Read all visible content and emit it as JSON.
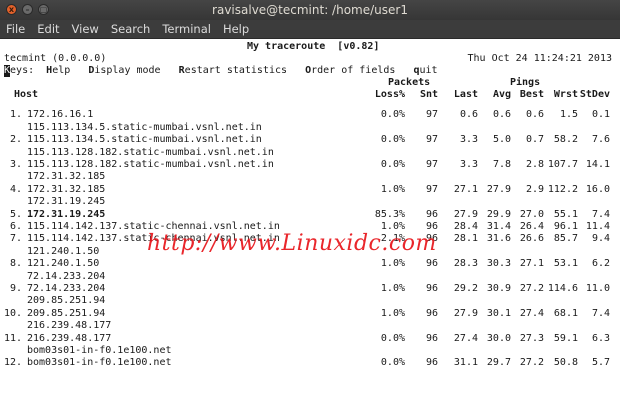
{
  "window": {
    "title": "ravisalve@tecmint: /home/user1",
    "close_glyph": "x",
    "min_glyph": "–",
    "max_glyph": "▢"
  },
  "menu": [
    "File",
    "Edit",
    "View",
    "Search",
    "Terminal",
    "Help"
  ],
  "mtr": {
    "title": "My traceroute  [v0.82]",
    "host_line": "tecmint (0.0.0.0)",
    "datetime": "Thu Oct 24 11:24:21 2013",
    "keys_label": "Keys:",
    "key_help": "Help",
    "key_display": "Display mode",
    "key_restart": "Restart statistics",
    "key_order": "Order of fields",
    "key_quit": "quit",
    "group_packets": "Packets",
    "group_pings": "Pings",
    "headers": [
      "Host",
      "Loss%",
      "Snt",
      "Last",
      "Avg",
      "Best",
      "Wrst",
      "StDev"
    ]
  },
  "rows": [
    {
      "n": "1.",
      "host": "172.16.16.1",
      "loss": "0.0%",
      "snt": "97",
      "last": "0.6",
      "avg": "0.6",
      "best": "0.6",
      "wrst": "1.5",
      "stdev": "0.1",
      "extra": [
        "115.113.134.5.static-mumbai.vsnl.net.in"
      ]
    },
    {
      "n": "2.",
      "host": "115.113.134.5.static-mumbai.vsnl.net.in",
      "loss": "0.0%",
      "snt": "97",
      "last": "3.3",
      "avg": "5.0",
      "best": "0.7",
      "wrst": "58.2",
      "stdev": "7.6",
      "extra": [
        "115.113.128.182.static-mumbai.vsnl.net.in"
      ]
    },
    {
      "n": "3.",
      "host": "115.113.128.182.static-mumbai.vsnl.net.in",
      "loss": "0.0%",
      "snt": "97",
      "last": "3.3",
      "avg": "7.8",
      "best": "2.8",
      "wrst": "107.7",
      "stdev": "14.1",
      "extra": [
        "172.31.32.185"
      ]
    },
    {
      "n": "4.",
      "host": "172.31.32.185",
      "loss": "1.0%",
      "snt": "97",
      "last": "27.1",
      "avg": "27.9",
      "best": "2.9",
      "wrst": "112.2",
      "stdev": "16.0",
      "extra": [
        "172.31.19.245"
      ]
    },
    {
      "n": "5.",
      "host": "172.31.19.245",
      "bold": true,
      "loss": "85.3%",
      "snt": "96",
      "last": "27.9",
      "avg": "29.9",
      "best": "27.0",
      "wrst": "55.1",
      "stdev": "7.4",
      "extra": []
    },
    {
      "n": "6.",
      "host": "115.114.142.137.static-chennai.vsnl.net.in",
      "loss": "1.0%",
      "snt": "96",
      "last": "28.4",
      "avg": "31.4",
      "best": "26.4",
      "wrst": "96.1",
      "stdev": "11.4",
      "extra": []
    },
    {
      "n": "7.",
      "host": "115.114.142.137.static-chennai.vsnl.net.in",
      "loss": "2.1%",
      "snt": "96",
      "last": "28.1",
      "avg": "31.6",
      "best": "26.6",
      "wrst": "85.7",
      "stdev": "9.4",
      "extra": [
        "121.240.1.50"
      ]
    },
    {
      "n": "8.",
      "host": "121.240.1.50",
      "loss": "1.0%",
      "snt": "96",
      "last": "28.3",
      "avg": "30.3",
      "best": "27.1",
      "wrst": "53.1",
      "stdev": "6.2",
      "extra": [
        "72.14.233.204"
      ]
    },
    {
      "n": "9.",
      "host": "72.14.233.204",
      "loss": "1.0%",
      "snt": "96",
      "last": "29.2",
      "avg": "30.9",
      "best": "27.2",
      "wrst": "114.6",
      "stdev": "11.0",
      "extra": [
        "209.85.251.94"
      ]
    },
    {
      "n": "10.",
      "host": "209.85.251.94",
      "loss": "1.0%",
      "snt": "96",
      "last": "27.9",
      "avg": "30.1",
      "best": "27.4",
      "wrst": "68.1",
      "stdev": "7.4",
      "extra": [
        "216.239.48.177"
      ]
    },
    {
      "n": "11.",
      "host": "216.239.48.177",
      "loss": "0.0%",
      "snt": "96",
      "last": "27.4",
      "avg": "30.0",
      "best": "27.3",
      "wrst": "59.1",
      "stdev": "6.3",
      "extra": [
        "bom03s01-in-f0.1e100.net"
      ]
    },
    {
      "n": "12.",
      "host": "bom03s01-in-f0.1e100.net",
      "loss": "0.0%",
      "snt": "96",
      "last": "31.1",
      "avg": "29.7",
      "best": "27.2",
      "wrst": "50.8",
      "stdev": "5.7",
      "extra": []
    }
  ],
  "watermark": "http://www.Linuxidc.com"
}
